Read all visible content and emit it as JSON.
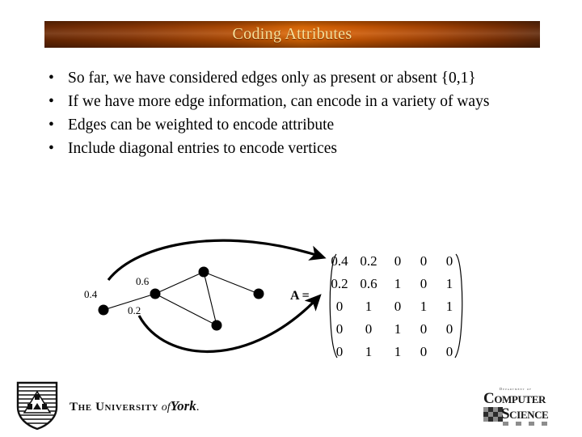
{
  "slide": {
    "title": "Coding Attributes",
    "title_bar_color_left": "#6d2a04",
    "title_bar_color_mid": "#e06a05",
    "title_bar_color_right": "#61290a",
    "title_text_color": "#f7e09a",
    "background_color": "#ffffff"
  },
  "bullets": [
    {
      "marker": "•",
      "text": "So far, we have considered edges only as present or absent {0,1}"
    },
    {
      "marker": "•",
      "text": "If  we have more edge information, can encode in a variety of ways"
    },
    {
      "marker": "•",
      "text": "Edges can be weighted to encode attribute"
    },
    {
      "marker": "•",
      "text": "Include diagonal entries to encode vertices"
    }
  ],
  "figure": {
    "graph": {
      "edge_weight_labels": [
        "0.4",
        "0.6",
        "0.2"
      ]
    },
    "matrix": {
      "label": "A =",
      "rows": [
        [
          "0.4",
          "0.2",
          "0",
          "0",
          "0"
        ],
        [
          "0.2",
          "0.6",
          "1",
          "0",
          "1"
        ],
        [
          "0",
          "1",
          "0",
          "1",
          "1"
        ],
        [
          "0",
          "0",
          "1",
          "0",
          "0"
        ],
        [
          "0",
          "1",
          "1",
          "0",
          "0"
        ]
      ]
    }
  },
  "footer": {
    "university_the": "The",
    "university_word": "University",
    "university_of": "of",
    "university_name": "York",
    "cs_dept_line": "Department of",
    "cs_line1": "Computer",
    "cs_line2": "Science"
  }
}
